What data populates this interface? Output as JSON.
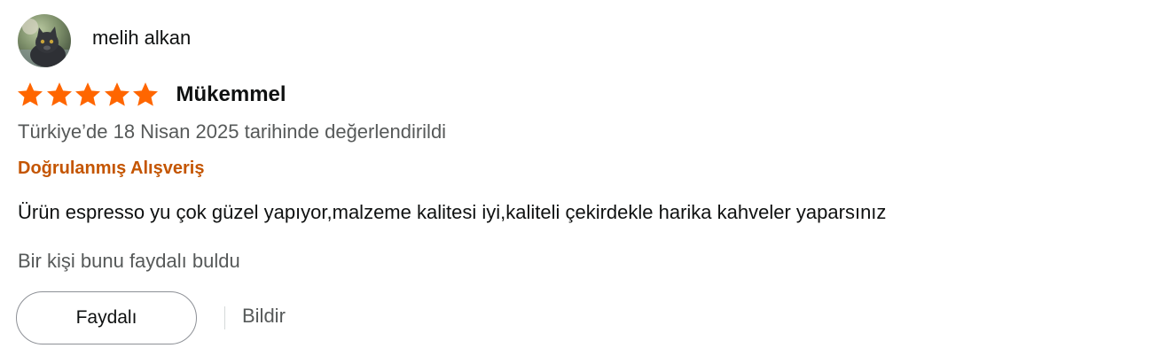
{
  "review": {
    "profile": {
      "name": "melih alkan",
      "avatar_icon": "profile-avatar-icon"
    },
    "rating": {
      "value": 5,
      "max": 5,
      "star_color": "#ff6600",
      "star_icon": "star-icon"
    },
    "title": "Mükemmel",
    "date": "Türkiye’de 18 Nisan 2025 tarihinde değerlendirildi",
    "verified_label": "Doğrulanmış Alışveriş",
    "body": "Ürün espresso yu çok güzel yapıyor,malzeme kalitesi iyi,kaliteli çekirdekle harika kahveler yaparsınız",
    "helpful_count_text": "Bir kişi bunu faydalı buldu",
    "actions": {
      "helpful_label": "Faydalı",
      "report_label": "Bildir"
    }
  },
  "colors": {
    "text_primary": "#0f1111",
    "text_secondary": "#565959",
    "verified": "#c45500",
    "star": "#ff6600",
    "button_border": "#8d9096"
  }
}
